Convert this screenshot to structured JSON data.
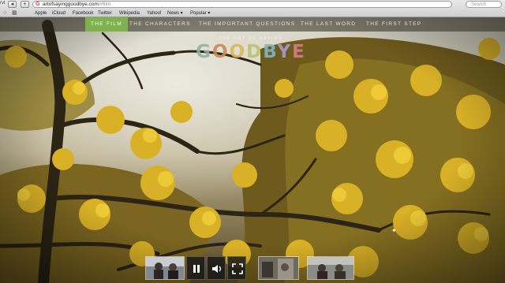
{
  "browser": {
    "left_label": "rvt",
    "url_domain": "artofsayinggoodbye.com",
    "url_path": "/#film",
    "search_placeholder": "Search",
    "bookmarks": [
      "Apple",
      "iCloud",
      "Facebook",
      "Twitter",
      "Wikipedia",
      "Yahoo!",
      "News ▾",
      "Popular ▾"
    ]
  },
  "site": {
    "nav": [
      "THE FILM",
      "THE CHARACTERS",
      "THE IMPORTANT QUESTIONS",
      "THE LAST WORD",
      "THE FIRST STEP"
    ],
    "active_nav": 0,
    "logo_top": "THE ART OF SAYING",
    "logo_main": "GOODBYE",
    "logo_colors": [
      "#8db3a0",
      "#c98a52",
      "#d6b95a",
      "#b8c470",
      "#7fb6c6",
      "#a89ad0",
      "#d47f86"
    ]
  },
  "player": {
    "pause_icon": "pause-icon",
    "volume_icon": "volume-icon",
    "fullscreen_icon": "fullscreen-icon"
  }
}
